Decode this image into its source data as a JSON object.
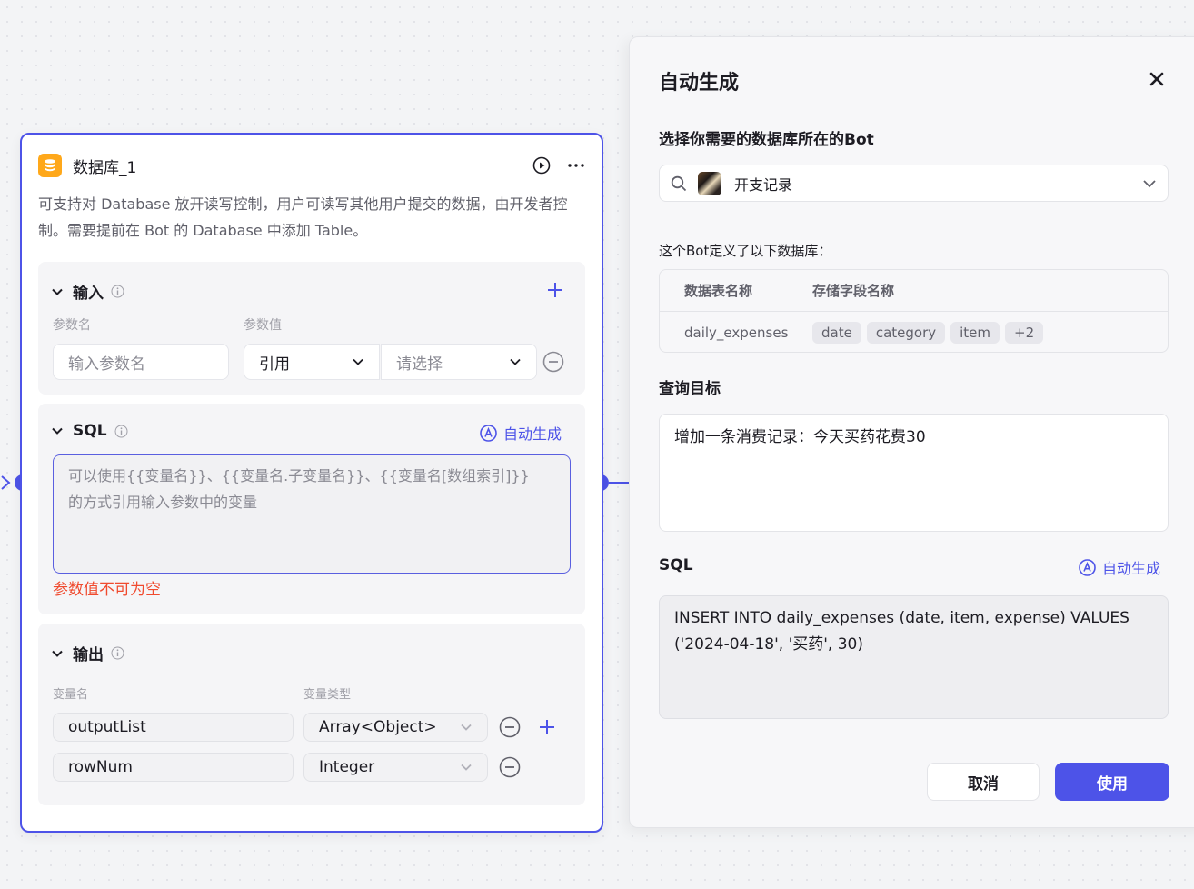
{
  "node": {
    "title": "数据库_1",
    "description": "可支持对 Database 放开读写控制，用户可读写其他用户提交的数据，由开发者控制。需要提前在 Bot 的 Database 中添加 Table。",
    "input": {
      "title": "输入",
      "col_name": "参数名",
      "col_value": "参数值",
      "name_placeholder": "输入参数名",
      "type_value": "引用",
      "ref_placeholder": "请选择"
    },
    "sql": {
      "title": "SQL",
      "auto_label": "自动生成",
      "placeholder_line1": "可以使用{{变量名}}、{{变量名.子变量名}}、{{变量名[数组索引]}}",
      "placeholder_line2": "的方式引用输入参数中的变量",
      "error": "参数值不可为空"
    },
    "output": {
      "title": "输出",
      "col_name": "变量名",
      "col_type": "变量类型",
      "rows": [
        {
          "name": "outputList",
          "type": "Array<Object>"
        },
        {
          "name": "rowNum",
          "type": "Integer"
        }
      ]
    }
  },
  "panel": {
    "title": "自动生成",
    "bot_label": "选择你需要的数据库所在的Bot",
    "bot_name": "开支记录",
    "db_note": "这个Bot定义了以下数据库：",
    "table_headers": {
      "name": "数据表名称",
      "fields": "存储字段名称"
    },
    "table_row": {
      "name": "daily_expenses",
      "fields": [
        "date",
        "category",
        "item"
      ],
      "more": "+2"
    },
    "goal_label": "查询目标",
    "goal_text": "增加一条消费记录：今天买药花费30",
    "sql_label": "SQL",
    "auto_label": "自动生成",
    "sql_line1": "INSERT INTO daily_expenses (date, item, expense) VALUES",
    "sql_line2": "('2024-04-18', '买药', 30)",
    "cancel": "取消",
    "use": "使用"
  },
  "colors": {
    "accent": "#4d53e8",
    "error": "#f04a2e",
    "db_icon": "#ffa81a"
  }
}
